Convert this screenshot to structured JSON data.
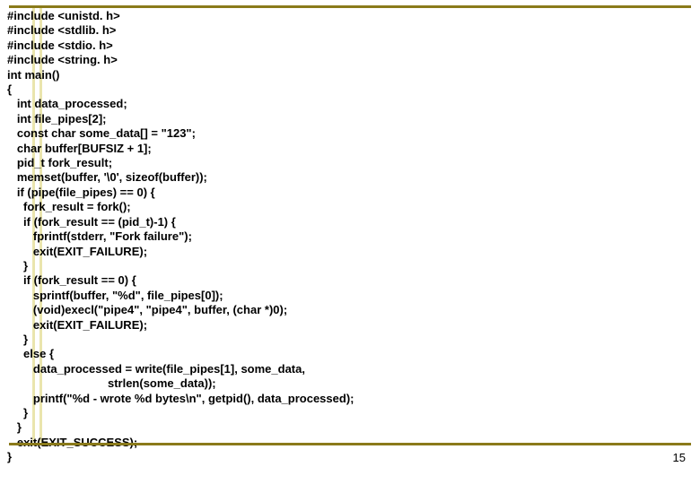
{
  "code": {
    "lines": [
      "#include <unistd. h>",
      "#include <stdlib. h>",
      "#include <stdio. h>",
      "#include <string. h>",
      "int main()",
      "{",
      "   int data_processed;",
      "   int file_pipes[2];",
      "   const char some_data[] = \"123\";",
      "   char buffer[BUFSIZ + 1];",
      "   pid_t fork_result;",
      "   memset(buffer, '\\0', sizeof(buffer));",
      "   if (pipe(file_pipes) == 0) {",
      "     fork_result = fork();",
      "     if (fork_result == (pid_t)-1) {",
      "        fprintf(stderr, \"Fork failure\");",
      "        exit(EXIT_FAILURE);",
      "     }",
      "     if (fork_result == 0) {",
      "        sprintf(buffer, \"%d\", file_pipes[0]);",
      "        (void)execl(\"pipe4\", \"pipe4\", buffer, (char *)0);",
      "        exit(EXIT_FAILURE);",
      "     }",
      "     else {",
      "        data_processed = write(file_pipes[1], some_data,",
      "                               strlen(some_data));",
      "        printf(\"%d - wrote %d bytes\\n\", getpid(), data_processed);",
      "     }",
      "   }",
      "   exit(EXIT_SUCCESS);",
      "}"
    ]
  },
  "page_number": "15"
}
